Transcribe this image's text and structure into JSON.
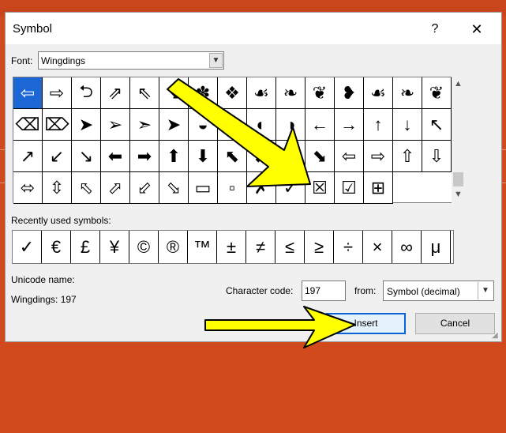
{
  "dialog": {
    "title": "Symbol",
    "help_label": "?",
    "close_label": "✕"
  },
  "font": {
    "label": "Font:",
    "value": "Wingdings"
  },
  "symbols": [
    "⇦",
    "⇨",
    "⮌",
    "⇗",
    "⇖",
    "⇘",
    "✽",
    "❖",
    "☙",
    "❧",
    "❦",
    "❥",
    "☙",
    "❧",
    "❦",
    "⌫",
    "⌦",
    "➤",
    "➢",
    "➣",
    "➤",
    "◒",
    "◓",
    "◐",
    "◑",
    "←",
    "→",
    "↑",
    "↓",
    "↖",
    "↗",
    "↙",
    "↘",
    "⬅",
    "➡",
    "⬆",
    "⬇",
    "⬉",
    "⬈",
    "⬋",
    "⬊",
    "⇦",
    "⇨",
    "⇧",
    "⇩",
    "⬄",
    "⇳",
    "⬁",
    "⬀",
    "⬃",
    "⬂",
    "▭",
    "▫",
    "✗",
    "✓",
    "☒",
    "☑",
    "⊞"
  ],
  "selected_symbol_index": 0,
  "recent": {
    "label": "Recently used symbols:",
    "items": [
      "✓",
      "€",
      "£",
      "¥",
      "©",
      "®",
      "™",
      "±",
      "≠",
      "≤",
      "≥",
      "÷",
      "×",
      "∞",
      "μ"
    ]
  },
  "unicode": {
    "label": "Unicode name:",
    "value": "Wingdings: 197"
  },
  "character_code": {
    "label": "Character code:",
    "value": "197"
  },
  "from": {
    "label": "from:",
    "value": "Symbol (decimal)"
  },
  "buttons": {
    "insert": "Insert",
    "cancel": "Cancel"
  },
  "colors": {
    "background": "#d04a1e",
    "selection": "#1c66d6",
    "annotation_arrow": "#ffff00"
  }
}
